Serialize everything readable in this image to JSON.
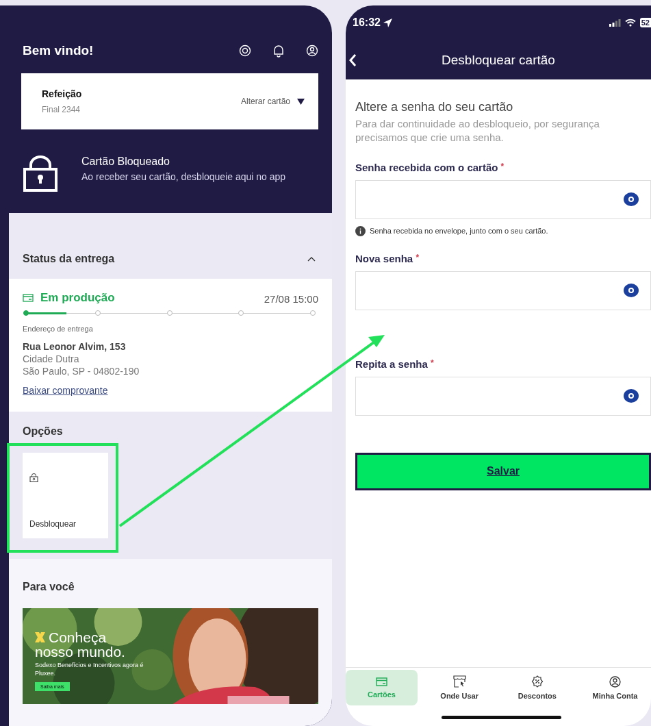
{
  "home_screen": {
    "greeting": "Bem vindo!",
    "card": {
      "name": "Refeição",
      "number": "Final 2344",
      "change_label": "Alterar cartão"
    },
    "blocked_notice": {
      "title": "Cartão Bloqueado",
      "text": "Ao receber seu cartão, desbloqueie aqui no app"
    },
    "delivery": {
      "title": "Status da entrega",
      "expanded": true,
      "status": "Em produção",
      "date": "27/08 15:00",
      "level": 0.14,
      "steps": [
        {
          "done": true
        },
        {
          "done": false
        },
        {
          "done": false
        },
        {
          "done": false
        },
        {
          "done": false
        }
      ],
      "address_label": "Endereço de entrega",
      "street": "Rua Leonor Alvim, 153",
      "district": "Cidade Dutra",
      "city": "São Paulo, SP - 04802-190",
      "receipt_link": "Baixar comprovante"
    },
    "options": {
      "title": "Opções",
      "items": [
        {
          "label": "Desbloquear",
          "highlighted": true
        }
      ]
    },
    "for_you": {
      "title": "Para você",
      "banner": {
        "kind": "picture",
        "headline": [
          "Conheça",
          "nosso mundo."
        ],
        "text": "Sodexo Benefícios e Incentivos agora é Pluxee.",
        "button": "Saiba mais"
      }
    }
  },
  "unlock_screen": {
    "status_bar": {
      "time": "16:32",
      "battery": "52"
    },
    "title": "Desbloquear cartão",
    "heading": "Altere a senha do seu cartão",
    "intro": "Para dar continuidade ao desbloqueio, por segurança precisamos que crie uma senha.",
    "fields": [
      {
        "label": "Senha recebida com o cartão",
        "mark": "*",
        "hint": "Senha recebida no envelope, junto com o seu cartão."
      },
      {
        "label": "Nova senha",
        "mark": "*"
      },
      {
        "label": "Repita a senha",
        "mark": "*"
      }
    ],
    "save_button": "Salvar",
    "tabs": [
      {
        "label": "Cartões",
        "selected": true,
        "kind": "card"
      },
      {
        "label": "Onde Usar",
        "selected": false,
        "kind": "store"
      },
      {
        "label": "Descontos",
        "selected": false,
        "kind": "discount"
      },
      {
        "label": "Minha Conta",
        "selected": false,
        "kind": "account"
      }
    ]
  }
}
